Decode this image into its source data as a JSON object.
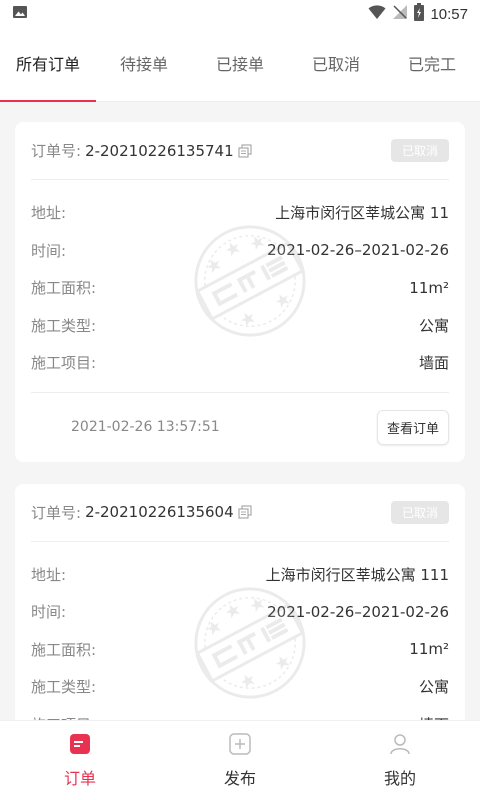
{
  "status_bar": {
    "time": "10:57"
  },
  "tabs": [
    {
      "label": "所有订单"
    },
    {
      "label": "待接单"
    },
    {
      "label": "已接单"
    },
    {
      "label": "已取消"
    },
    {
      "label": "已完工"
    }
  ],
  "field_labels": {
    "order_no": "订单号:",
    "address": "地址:",
    "time": "时间:",
    "area": "施工面积:",
    "type": "施工类型:",
    "project": "施工项目:"
  },
  "orders": [
    {
      "order_no": "2-20210226135741",
      "status": "已取消",
      "address": "上海市闵行区莘城公寓 11",
      "time": "2021-02-26–2021-02-26",
      "area": "11m²",
      "type": "公寓",
      "project": "墙面",
      "created": "2021-02-26 13:57:51",
      "view_button": "查看订单"
    },
    {
      "order_no": "2-20210226135604",
      "status": "已取消",
      "address": "上海市闵行区莘城公寓 111",
      "time": "2021-02-26–2021-02-26",
      "area": "11m²",
      "type": "公寓",
      "project": "墙面"
    }
  ],
  "bottom_nav": [
    {
      "label": "订单",
      "icon": "orders-icon"
    },
    {
      "label": "发布",
      "icon": "publish-icon"
    },
    {
      "label": "我的",
      "icon": "profile-icon"
    }
  ],
  "colors": {
    "accent": "#e8324f",
    "badge_bg": "#e6e6e6"
  }
}
